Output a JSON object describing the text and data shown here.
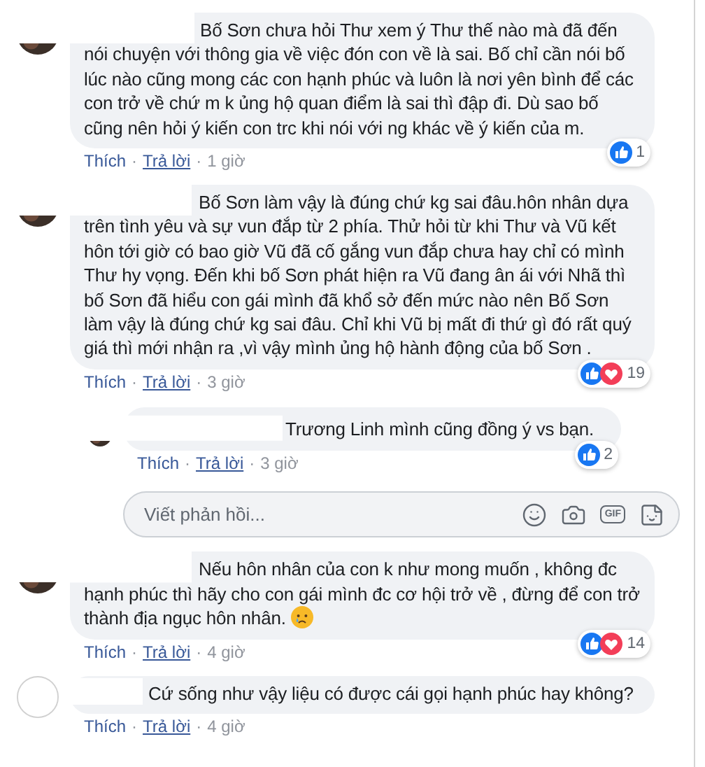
{
  "comments": [
    {
      "avatar": {
        "kind": "photo"
      },
      "text": "Bố Sơn chưa hỏi Thư xem ý Thư thế nào mà đã đến nói chuyện với thông gia về việc đón con về là sai. Bố chỉ cần nói bố lúc nào cũng mong các con hạnh phúc và luôn là nơi yên bình để các con trở về chứ m k ủng hộ quan điểm là sai thì đập đi. Dù sao bố cũng nên hỏi ý kiến con trc khi nói với ng khác về ý kiến của m.",
      "reactions": [
        {
          "kind": "like"
        }
      ],
      "reaction_count": "1",
      "like_label": "Thích",
      "separator": "·",
      "reply_label": "Trả lời",
      "time": "1 giờ"
    },
    {
      "avatar": {
        "kind": "photo"
      },
      "text": "Bố Sơn làm vậy là đúng chứ kg sai đâu.hôn nhân dựa trên tình yêu và sự vun đắp từ 2 phía. Thử hỏi từ khi Thư và Vũ kết hôn tới giờ có bao giờ Vũ đã cố gắng vun đắp chưa hay chỉ có mình Thư hy vọng. Đến khi bố Sơn phát hiện ra Vũ đang ân ái với Nhã thì bố Sơn đã hiểu con gái mình đã khổ sở đến mức nào nên Bố Sơn làm vậy là đúng chứ kg sai đâu. Chỉ khi Vũ bị mất đi thứ gì đó rất quý giá thì mới nhận ra ,vì vậy mình ủng hộ hành động của bố Sơn .",
      "reactions": [
        {
          "kind": "like"
        },
        {
          "kind": "love"
        }
      ],
      "reaction_count": "19",
      "like_label": "Thích",
      "separator": "·",
      "reply_label": "Trả lời",
      "time": "3 giờ",
      "replies": [
        {
          "avatar": {
            "kind": "photo"
          },
          "text": "Trương Linh mình cũng đồng ý vs bạn.",
          "reactions": [
            {
              "kind": "like"
            }
          ],
          "reaction_count": "2",
          "like_label": "Thích",
          "separator": "·",
          "reply_label": "Trả lời",
          "time": "3 giờ"
        }
      ],
      "reply_box": {
        "placeholder": "Viết phản hồi...",
        "gif_label": "GIF"
      }
    },
    {
      "avatar": {
        "kind": "photo"
      },
      "text": "Nếu hôn nhân của con k như mong muốn , không đc hạnh phúc thì hãy cho con gái mình đc cơ hội trở về , đừng để con trở thành địa ngục hôn nhân.",
      "emoji": {
        "kind": "crying"
      },
      "reactions": [
        {
          "kind": "like"
        },
        {
          "kind": "love"
        }
      ],
      "reaction_count": "14",
      "like_label": "Thích",
      "separator": "·",
      "reply_label": "Trả lời",
      "time": "4 giờ"
    },
    {
      "avatar": {
        "kind": "blank"
      },
      "text": "Cứ sống như vậy liệu có được cái gọi hạnh phúc hay không?",
      "like_label": "Thích",
      "separator": "·",
      "reply_label": "Trả lời",
      "time": "4 giờ"
    }
  ]
}
